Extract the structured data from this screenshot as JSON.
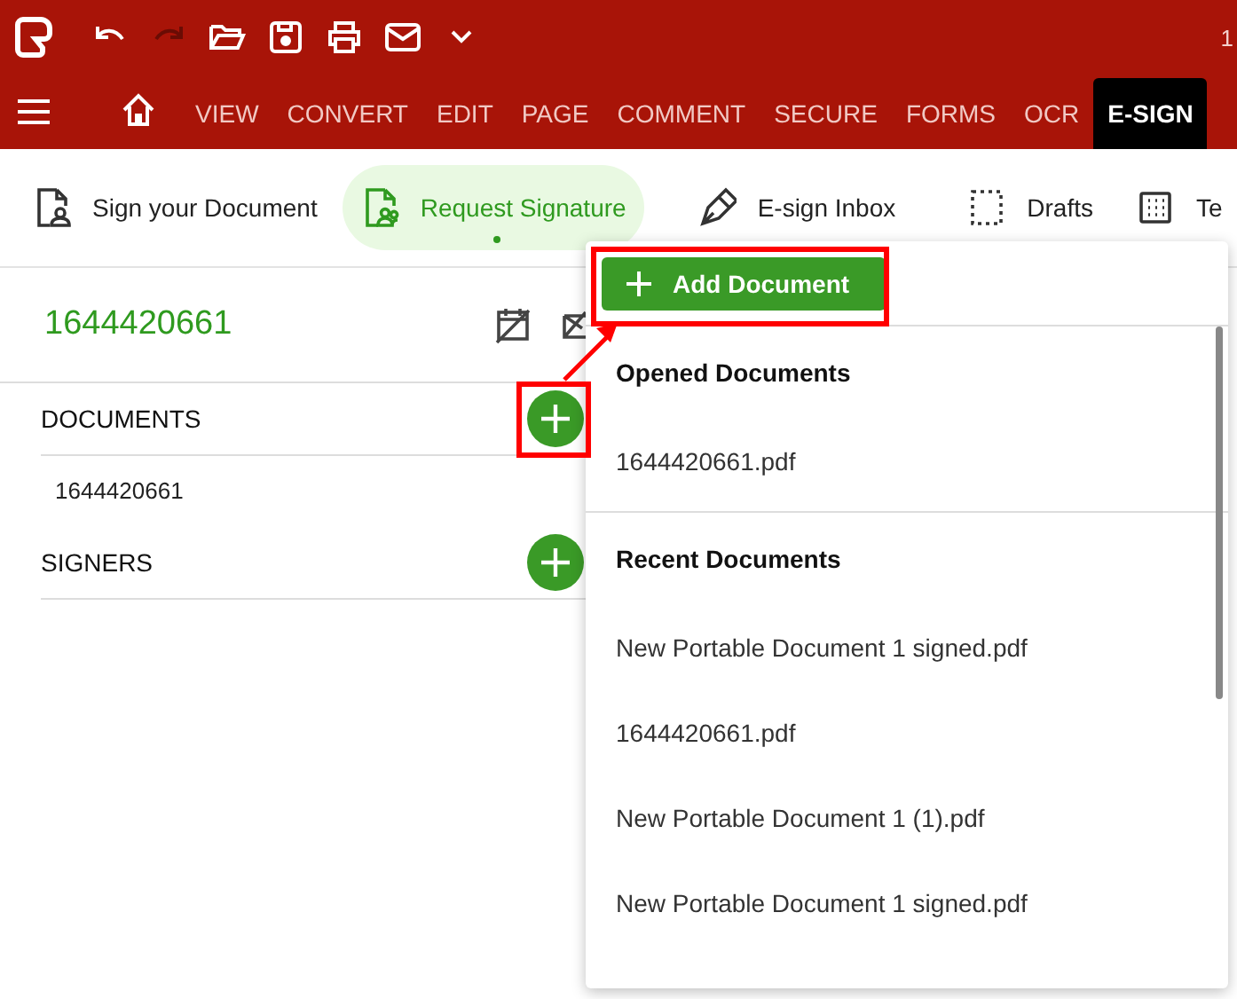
{
  "quick_access": [
    {
      "kind": "undo",
      "disabled": false
    },
    {
      "kind": "redo",
      "disabled": true
    },
    {
      "kind": "open",
      "disabled": false
    },
    {
      "kind": "save",
      "disabled": false
    },
    {
      "kind": "print",
      "disabled": false
    },
    {
      "kind": "mail",
      "disabled": false
    },
    {
      "kind": "more",
      "disabled": false
    }
  ],
  "page_counter": "1",
  "menu_tabs": [
    {
      "label": "VIEW",
      "selected": false
    },
    {
      "label": "CONVERT",
      "selected": false
    },
    {
      "label": "EDIT",
      "selected": false
    },
    {
      "label": "PAGE",
      "selected": false
    },
    {
      "label": "COMMENT",
      "selected": false
    },
    {
      "label": "SECURE",
      "selected": false
    },
    {
      "label": "FORMS",
      "selected": false
    },
    {
      "label": "OCR",
      "selected": false
    },
    {
      "label": "E-SIGN",
      "selected": true
    }
  ],
  "ribbon": [
    {
      "kind": "sign",
      "label": "Sign your Document",
      "selected": false
    },
    {
      "kind": "request",
      "label": "Request Signature",
      "selected": true
    },
    {
      "kind": "inbox",
      "label": "E-sign Inbox",
      "selected": false
    },
    {
      "kind": "drafts",
      "label": "Drafts",
      "selected": false
    },
    {
      "kind": "templates",
      "label": "Te",
      "selected": false
    }
  ],
  "sidebar": {
    "title": "1644420661",
    "sections": [
      {
        "heading": "DOCUMENTS",
        "items": [
          "1644420661"
        ]
      },
      {
        "heading": "SIGNERS"
      }
    ]
  },
  "popup": {
    "add_button": "Add Document",
    "groups": [
      {
        "heading": "Opened Documents",
        "items": [
          "1644420661.pdf"
        ]
      },
      {
        "heading": "Recent Documents",
        "items": [
          "New Portable Document 1 signed.pdf",
          "1644420661.pdf",
          "New Portable Document 1 (1).pdf",
          "New Portable Document 1 signed.pdf"
        ]
      }
    ]
  }
}
